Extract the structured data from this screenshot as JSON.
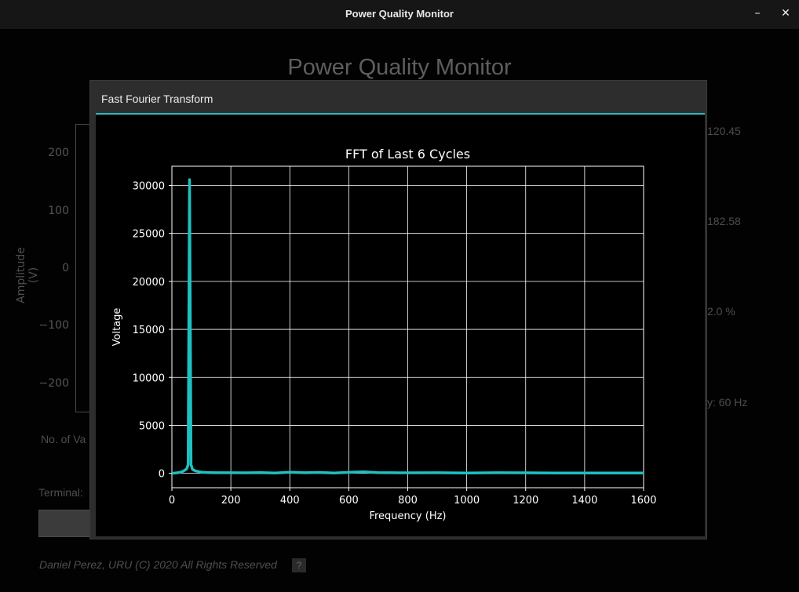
{
  "window": {
    "title": "Power Quality Monitor",
    "minimize_glyph": "–",
    "close_glyph": "✕"
  },
  "background": {
    "heading": "Power Quality Monitor",
    "ylabel": "Amplitude (V)",
    "yticks": [
      "200",
      "100",
      "0",
      "−100",
      "−200"
    ],
    "right_values": [
      "120.45",
      "182.58",
      "2.0 %",
      "y: 60 Hz"
    ],
    "no_values_label": "No. of Va",
    "terminal_label": "Terminal:",
    "footer": "Daniel Perez, URU (C) 2020 All Rights Reserved",
    "help_label": "?"
  },
  "dialog": {
    "title": "Fast Fourier Transform",
    "accent_color": "#2ab4c4"
  },
  "chart_data": {
    "type": "line",
    "title": "FFT of Last 6 Cycles",
    "xlabel": "Frequency (Hz)",
    "ylabel": "Voltage",
    "xlim": [
      0,
      1600
    ],
    "ylim": [
      -1500,
      32000
    ],
    "xticks": [
      0,
      200,
      400,
      600,
      800,
      1000,
      1200,
      1400,
      1600
    ],
    "yticks": [
      0,
      5000,
      10000,
      15000,
      20000,
      25000,
      30000
    ],
    "grid": true,
    "line_color": "#1fc0c0",
    "series": [
      {
        "x": [
          0,
          10,
          20,
          30,
          40,
          50,
          55,
          60,
          65,
          70,
          80,
          100,
          130,
          150,
          200,
          250,
          300,
          350,
          400,
          450,
          500,
          550,
          600,
          650,
          700,
          750,
          800,
          900,
          1000,
          1100,
          1200,
          1300,
          1400,
          1500,
          1600
        ],
        "y": [
          0,
          30,
          60,
          120,
          250,
          450,
          900,
          30600,
          900,
          400,
          250,
          120,
          80,
          60,
          60,
          50,
          80,
          40,
          120,
          60,
          90,
          40,
          100,
          150,
          80,
          60,
          50,
          60,
          40,
          60,
          50,
          40,
          40,
          40,
          30
        ]
      }
    ]
  }
}
